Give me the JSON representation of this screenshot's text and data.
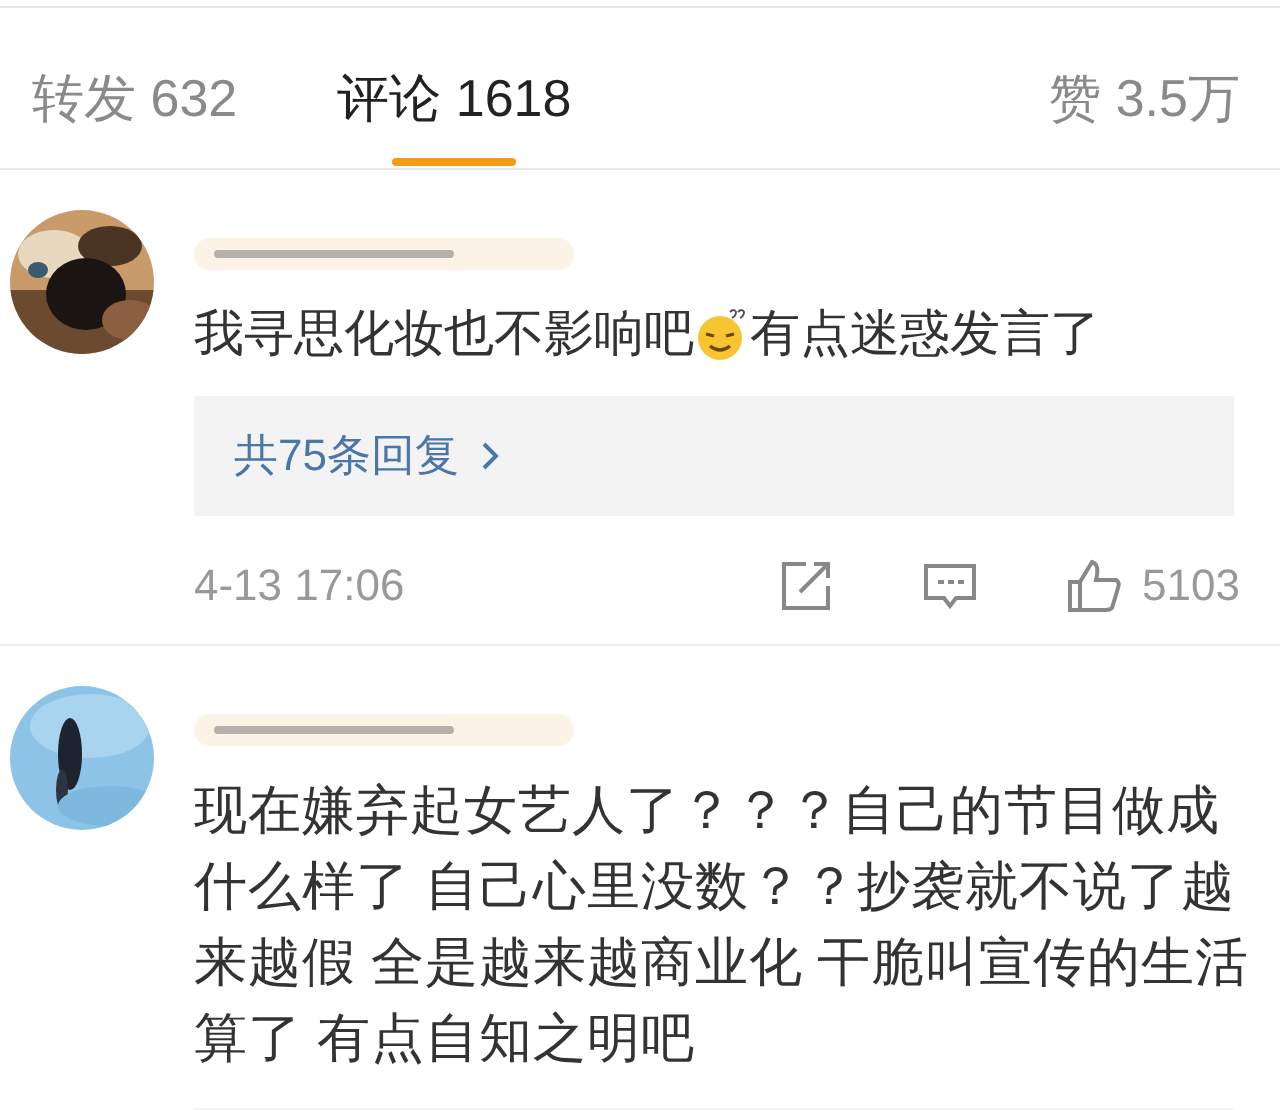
{
  "tabs": [
    {
      "label": "转发",
      "count": "632",
      "selected": false
    },
    {
      "label": "评论",
      "count": "1618",
      "selected": true
    },
    {
      "label": "赞",
      "count": "3.5万",
      "selected": false
    }
  ],
  "comments": [
    {
      "avatar": {
        "kind": "picture"
      },
      "content": [
        {
          "kind": "text",
          "text": "我寻思化妆也不影响吧"
        },
        {
          "kind": "emoji"
        },
        {
          "kind": "text",
          "text": "有点迷惑发言了"
        }
      ],
      "replies": "共75条回复",
      "time": "4-13 17:06",
      "likes": "5103"
    },
    {
      "avatar": {
        "kind": "picture"
      },
      "content": [
        {
          "kind": "text",
          "text": "现在嫌弃起女艺人了？？？自己的节目做成什么样了 自己心里没数？？抄袭就不说了越来越假  全是越来越商业化 干脆叫宣传的生活算了 有点自知之明吧"
        }
      ]
    }
  ]
}
